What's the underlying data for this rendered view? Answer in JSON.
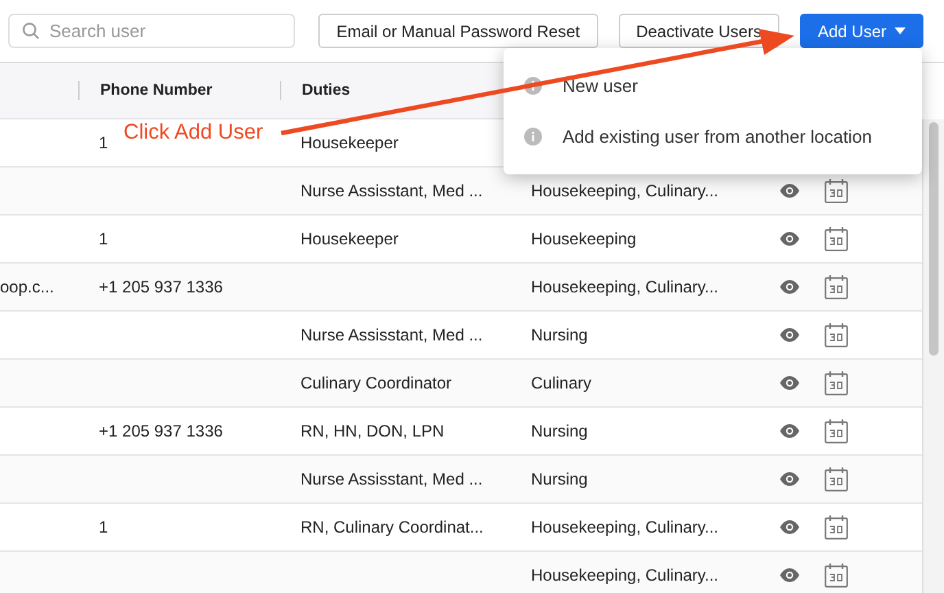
{
  "search": {
    "placeholder": "Search user"
  },
  "toolbar_buttons": [
    {
      "label": "Email or Manual Password Reset",
      "kind": "plain"
    },
    {
      "label": "Deactivate Users",
      "kind": "plain"
    },
    {
      "label": "Add User",
      "kind": "primary"
    }
  ],
  "table": {
    "columns": [
      "Phone Number",
      "Duties"
    ],
    "rows": [
      {
        "column_1": "",
        "phone": "1",
        "duties": "Housekeeper",
        "department": "",
        "actions_shown": false
      },
      {
        "column_1": "",
        "phone": "",
        "duties": "Nurse Assisstant, Med ...",
        "department": "Housekeeping, Culinary...",
        "actions_shown": true
      },
      {
        "column_1": "",
        "phone": "1",
        "duties": "Housekeeper",
        "department": "Housekeeping",
        "actions_shown": true
      },
      {
        "column_1": "oop.c...",
        "phone": "+1 205 937 1336",
        "duties": "",
        "department": "Housekeeping, Culinary...",
        "actions_shown": true
      },
      {
        "column_1": "",
        "phone": "",
        "duties": "Nurse Assisstant, Med ...",
        "department": "Nursing",
        "actions_shown": true
      },
      {
        "column_1": "",
        "phone": "",
        "duties": "Culinary Coordinator",
        "department": "Culinary",
        "actions_shown": true
      },
      {
        "column_1": "",
        "phone": "+1 205 937 1336",
        "duties": "RN, HN, DON, LPN",
        "department": "Nursing",
        "actions_shown": true
      },
      {
        "column_1": "",
        "phone": "",
        "duties": "Nurse Assisstant, Med ...",
        "department": "Nursing",
        "actions_shown": true
      },
      {
        "column_1": "",
        "phone": "1",
        "duties": "RN, Culinary Coordinat...",
        "department": "Housekeeping, Culinary...",
        "actions_shown": true
      },
      {
        "column_1": "",
        "phone": "",
        "duties": "",
        "department": "Housekeeping, Culinary...",
        "actions_shown": true
      }
    ]
  },
  "dropdown": {
    "items": [
      {
        "label": "New user"
      },
      {
        "label": "Add existing user from another location"
      }
    ]
  },
  "annotation": {
    "text": "Click Add User"
  }
}
